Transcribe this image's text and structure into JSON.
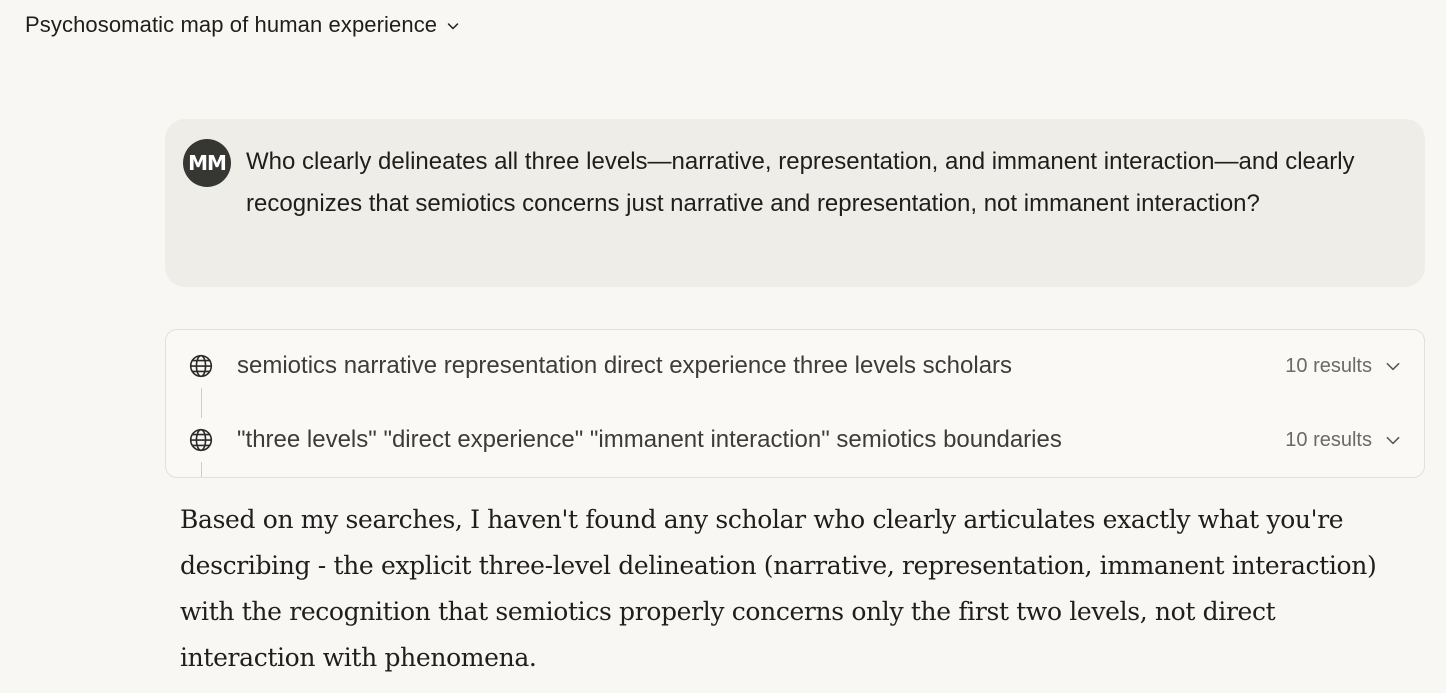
{
  "header": {
    "title": "Psychosomatic map of human experience",
    "title_icon": "chevron-down-icon"
  },
  "user_message": {
    "avatar_initials": "MM",
    "avatar_color": "#363633",
    "text": "Who clearly delineates all three levels—narrative, representation, and immanent interaction—and clearly recognizes that semiotics concerns just narrative and representation, not immanent interaction?"
  },
  "searches": [
    {
      "icon": "globe-icon",
      "query": "semiotics narrative representation direct experience three levels scholars",
      "results_label": "10 results",
      "expand_icon": "chevron-down-icon"
    },
    {
      "icon": "globe-icon",
      "query": "\"three levels\" \"direct experience\" \"immanent interaction\" semiotics boundaries",
      "results_label": "10 results",
      "expand_icon": "chevron-down-icon"
    }
  ],
  "assistant_message": {
    "text": "Based on my searches, I haven't found any scholar who clearly articulates exactly what you're describing - the explicit three-level delineation (narrative, representation, immanent interaction) with the recognition that semiotics properly concerns only the first two levels, not direct interaction with phenomena."
  },
  "colors": {
    "page_background": "#f8f7f4",
    "user_bubble": "#efede8",
    "search_border": "#e2e0da",
    "text_primary": "#1f1e1d",
    "text_secondary": "#6b6a66"
  }
}
